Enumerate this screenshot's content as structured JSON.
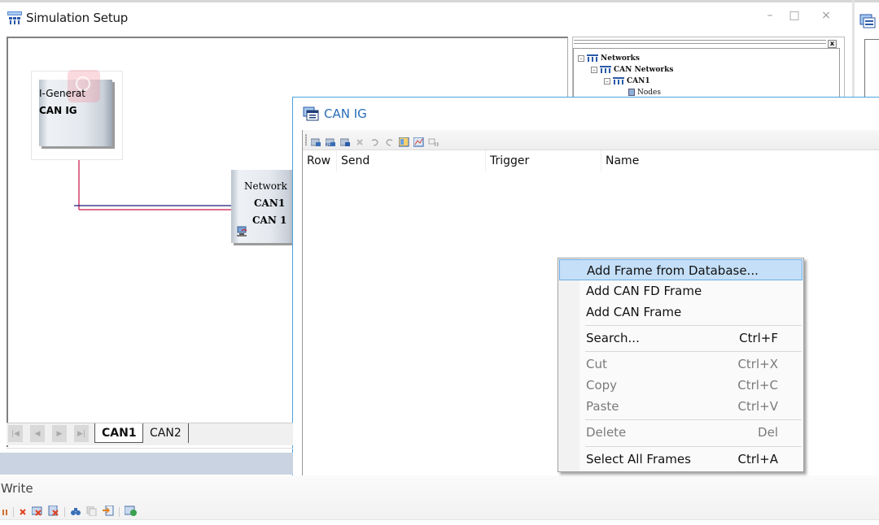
{
  "simulation_setup": {
    "title": "Simulation Setup",
    "window_controls": {
      "minimize": "–",
      "maximize": "□",
      "close": "×"
    },
    "nodes": {
      "interactive_generator": {
        "line1": "I-Generat",
        "line2": "CAN IG"
      },
      "network": {
        "line1": "Network",
        "line2": "CAN1",
        "line3": "CAN 1"
      }
    },
    "tabs": [
      {
        "label": "CAN1",
        "active": true
      },
      {
        "label": "CAN2",
        "active": false
      }
    ],
    "tab_nav": [
      "|◀",
      "◀",
      "▶",
      "▶|"
    ]
  },
  "tree": {
    "close_label": "x",
    "items": [
      {
        "label": "Networks",
        "expander": "–"
      },
      {
        "label": "CAN Networks",
        "expander": "–"
      },
      {
        "label": "CAN1",
        "expander": "–"
      },
      {
        "label": "Nodes"
      }
    ]
  },
  "can_ig_window": {
    "title": "CAN IG",
    "toolbar_icons": [
      "add-frame-icon",
      "add-fd-frame-icon",
      "add-from-db-icon",
      "delete-icon",
      "undo-icon",
      "redo-icon",
      "layout-icon",
      "chart-icon",
      "signal-icon"
    ],
    "columns": [
      "Row",
      "Send",
      "Trigger",
      "Name"
    ]
  },
  "context_menu": {
    "items": [
      {
        "label": "Add Frame from Database...",
        "shortcut": "",
        "highlighted": true,
        "disabled": false
      },
      {
        "label": "Add CAN FD Frame",
        "shortcut": "",
        "disabled": false
      },
      {
        "label": "Add CAN Frame",
        "shortcut": "",
        "disabled": false
      },
      {
        "label": "Search...",
        "shortcut": "Ctrl+F",
        "disabled": false
      },
      {
        "label": "Cut",
        "shortcut": "Ctrl+X",
        "disabled": true
      },
      {
        "label": "Copy",
        "shortcut": "Ctrl+C",
        "disabled": true
      },
      {
        "label": "Paste",
        "shortcut": "Ctrl+V",
        "disabled": true
      },
      {
        "label": "Delete",
        "shortcut": "Del",
        "disabled": true
      },
      {
        "label": "Select All Frames",
        "shortcut": "Ctrl+A",
        "disabled": false
      }
    ]
  },
  "write_pane": {
    "title": "Write",
    "toolbar_icons": [
      "pause-icon",
      "clear-icon",
      "clear-window-icon",
      "clear-all-icon",
      "find-icon",
      "copy-icon",
      "export-icon",
      "options-icon"
    ]
  },
  "colors": {
    "accent_blue": "#2a6db8",
    "window_border": "#4aa3df",
    "menu_highlight": "#c4dff7",
    "wire_red": "#d0406a",
    "wire_navy": "#1a1a7a",
    "status_bar": "#c9d3e2"
  }
}
